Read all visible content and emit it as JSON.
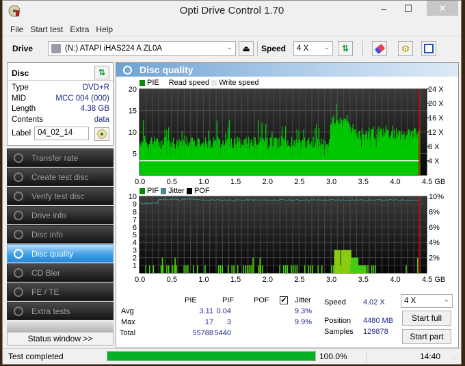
{
  "window": {
    "title": "Opti Drive Control 1.70",
    "controls": {
      "minimize": "‒",
      "maximize": "☐",
      "close": "✕"
    }
  },
  "menu": [
    "File",
    "Start test",
    "Extra",
    "Help"
  ],
  "toolbar": {
    "drive_label": "Drive",
    "drive_value": "(N:)  ATAPI iHAS224   A ZL0A",
    "speed_label": "Speed",
    "speed_value": "4 X",
    "icons": [
      "eject-icon",
      "refresh-icon",
      "erase-icon",
      "settings-icon",
      "save-icon"
    ]
  },
  "disc": {
    "header": "Disc",
    "fields": [
      {
        "key": "Type",
        "value": "DVD+R"
      },
      {
        "key": "MID",
        "value": "MCC 004 (000)"
      },
      {
        "key": "Length",
        "value": "4.38 GB"
      },
      {
        "key": "Contents",
        "value": "data"
      }
    ],
    "label_key": "Label",
    "label_value": "04_02_14"
  },
  "nav": [
    {
      "label": "Transfer rate",
      "active": false
    },
    {
      "label": "Create test disc",
      "active": false
    },
    {
      "label": "Verify test disc",
      "active": false
    },
    {
      "label": "Drive info",
      "active": false
    },
    {
      "label": "Disc info",
      "active": false
    },
    {
      "label": "Disc quality",
      "active": true
    },
    {
      "label": "CD Bler",
      "active": false
    },
    {
      "label": "FE / TE",
      "active": false
    },
    {
      "label": "Extra tests",
      "active": false
    }
  ],
  "status_window_button": "Status window >>",
  "panel": {
    "title": "Disc quality"
  },
  "colors": {
    "pie": "#00c800",
    "pif": "#4ad400",
    "jitter": "#3a8c8c",
    "pof": "#000000",
    "read_speed": "#ffffff",
    "end_marker": "#e00000",
    "progress": "#06b025"
  },
  "chart_data": [
    {
      "type": "bar",
      "title": "PIE",
      "legend": [
        "PIE",
        "Read speed",
        "Write speed"
      ],
      "xlabel": "GB",
      "x_ticks": [
        "0.0",
        "0.5",
        "1.0",
        "1.5",
        "2.0",
        "2.5",
        "3.0",
        "3.5",
        "4.0",
        "4.5 GB"
      ],
      "xlim": [
        0,
        4.5
      ],
      "y_ticks": [
        "5",
        "10",
        "15",
        "20"
      ],
      "ylim": [
        0,
        20
      ],
      "y2_ticks": [
        "4 X",
        "8 X",
        "12 X",
        "16 X",
        "20 X",
        "24 X"
      ],
      "y2lim": [
        0,
        24
      ],
      "end_marker_gb": 4.38,
      "read_speed_x": 4.02,
      "pie_profile": [
        {
          "from": 0.0,
          "to": 3.0,
          "base": 6,
          "peak": 13
        },
        {
          "from": 3.0,
          "to": 3.3,
          "base": 11,
          "peak": 17
        },
        {
          "from": 3.3,
          "to": 4.38,
          "base": 8,
          "peak": 12
        }
      ]
    },
    {
      "type": "bar",
      "title": "PIF / Jitter",
      "legend": [
        "PIF",
        "Jitter",
        "POF"
      ],
      "xlabel": "GB",
      "x_ticks": [
        "0.0",
        "0.5",
        "1.0",
        "1.5",
        "2.0",
        "2.5",
        "3.0",
        "3.5",
        "4.0",
        "4.5 GB"
      ],
      "xlim": [
        0,
        4.5
      ],
      "y_ticks": [
        "1",
        "2",
        "3",
        "4",
        "5",
        "6",
        "7",
        "8",
        "9",
        "10"
      ],
      "ylim": [
        0,
        10
      ],
      "y2_ticks": [
        "2%",
        "4%",
        "6%",
        "8%",
        "10%"
      ],
      "y2lim": [
        0,
        10
      ],
      "jitter_avg_percent": 9.3,
      "pif_spikes": [
        {
          "gb": 0.35,
          "v": 2
        },
        {
          "gb": 0.55,
          "v": 2
        },
        {
          "gb": 1.77,
          "v": 2
        },
        {
          "gb": 1.88,
          "v": 2
        },
        {
          "gb": 4.35,
          "v": 2
        }
      ],
      "pif_blocks": [
        {
          "from": 3.05,
          "to": 3.15,
          "v": 3
        },
        {
          "from": 3.16,
          "to": 3.32,
          "v": 3
        },
        {
          "from": 3.32,
          "to": 3.43,
          "v": 2
        },
        {
          "from": 3.3,
          "to": 3.55,
          "v": 1
        }
      ]
    }
  ],
  "stats": {
    "headers": [
      "PIE",
      "PIF",
      "POF",
      "Jitter"
    ],
    "jitter_checked": true,
    "rows": [
      {
        "label": "Avg",
        "pie": "3.11",
        "pif": "0.04",
        "pof": "",
        "jitter": "9.3%"
      },
      {
        "label": "Max",
        "pie": "17",
        "pif": "3",
        "pof": "",
        "jitter": "9.9%"
      },
      {
        "label": "Total",
        "pie": "55788",
        "pif": "5440",
        "pof": "",
        "jitter": ""
      }
    ],
    "speed_label": "Speed",
    "speed_value": "4.02 X",
    "position_label": "Position",
    "position_value": "4480 MB",
    "samples_label": "Samples",
    "samples_value": "129878",
    "speed_select": "4 X",
    "start_full": "Start full",
    "start_part": "Start part"
  },
  "statusbar": {
    "text": "Test completed",
    "progress_percent": 100.0,
    "progress_text": "100.0%",
    "time": "14:40"
  }
}
